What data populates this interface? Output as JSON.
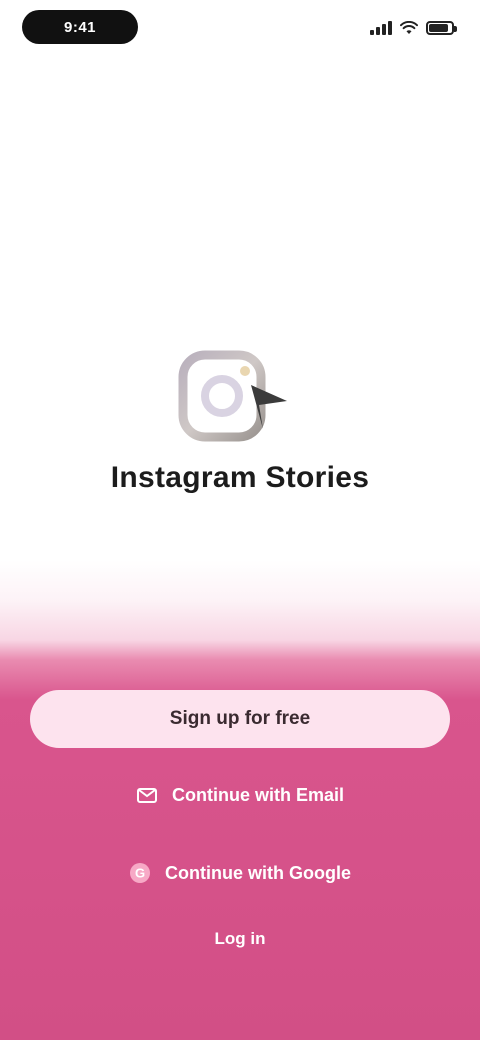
{
  "status_bar": {
    "time": "9:41"
  },
  "brand": {
    "app_name": "Instagram Stories",
    "logo_icon": "instagram-camera-icon"
  },
  "actions": {
    "primary_label": "Sign up for free",
    "secondary_1_label": "Continue with Email",
    "secondary_1_icon": "email-icon",
    "secondary_2_label": "Continue with Google",
    "secondary_2_icon": "google-icon",
    "login_label": "Log in"
  },
  "colors": {
    "accent": "#d24f86",
    "primary_button_bg": "#fde3ee"
  }
}
